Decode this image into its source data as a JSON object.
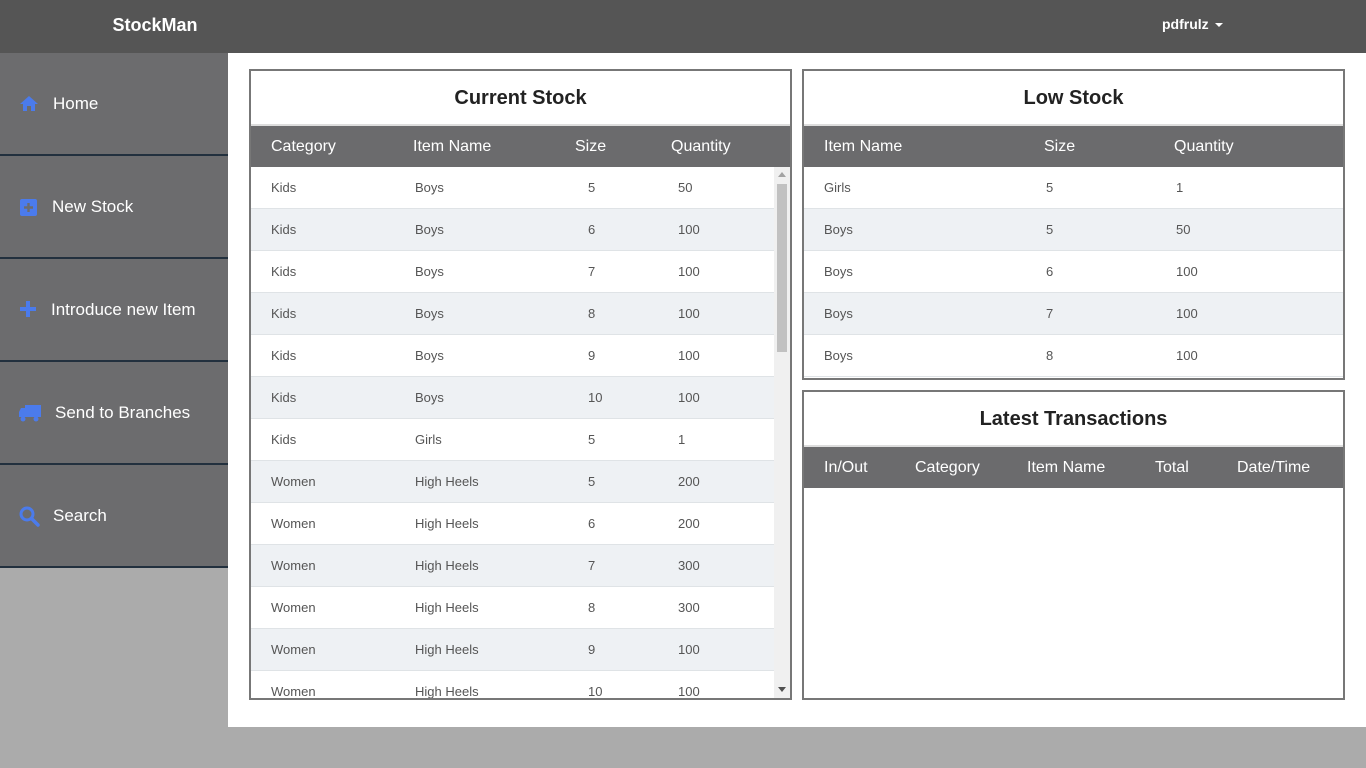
{
  "app": {
    "brand": "StockMan",
    "user": "pdfrulz"
  },
  "sidebar": {
    "items": [
      {
        "label": "Home",
        "icon": "home-icon"
      },
      {
        "label": "New Stock",
        "icon": "plus-square-icon"
      },
      {
        "label": "Introduce new Item",
        "icon": "plus-icon"
      },
      {
        "label": "Send to Branches",
        "icon": "truck-icon"
      },
      {
        "label": "Search",
        "icon": "search-icon"
      }
    ]
  },
  "current_stock": {
    "title": "Current Stock",
    "columns": [
      "Category",
      "Item Name",
      "Size",
      "Quantity"
    ],
    "rows": [
      [
        "Kids",
        "Boys",
        "5",
        "50"
      ],
      [
        "Kids",
        "Boys",
        "6",
        "100"
      ],
      [
        "Kids",
        "Boys",
        "7",
        "100"
      ],
      [
        "Kids",
        "Boys",
        "8",
        "100"
      ],
      [
        "Kids",
        "Boys",
        "9",
        "100"
      ],
      [
        "Kids",
        "Boys",
        "10",
        "100"
      ],
      [
        "Kids",
        "Girls",
        "5",
        "1"
      ],
      [
        "Women",
        "High Heels",
        "5",
        "200"
      ],
      [
        "Women",
        "High Heels",
        "6",
        "200"
      ],
      [
        "Women",
        "High Heels",
        "7",
        "300"
      ],
      [
        "Women",
        "High Heels",
        "8",
        "300"
      ],
      [
        "Women",
        "High Heels",
        "9",
        "100"
      ],
      [
        "Women",
        "High Heels",
        "10",
        "100"
      ]
    ]
  },
  "low_stock": {
    "title": "Low Stock",
    "columns": [
      "Item Name",
      "Size",
      "Quantity"
    ],
    "rows": [
      [
        "Girls",
        "5",
        "1"
      ],
      [
        "Boys",
        "5",
        "50"
      ],
      [
        "Boys",
        "6",
        "100"
      ],
      [
        "Boys",
        "7",
        "100"
      ],
      [
        "Boys",
        "8",
        "100"
      ]
    ]
  },
  "transactions": {
    "title": "Latest Transactions",
    "columns": [
      "In/Out",
      "Category",
      "Item Name",
      "Total",
      "Date/Time"
    ],
    "rows": []
  },
  "colors": {
    "topbar": "#555555",
    "sidebar_item": "#6c6c6e",
    "icon_accent": "#4b7bec",
    "table_header": "#6b6b6d",
    "row_alt": "#eef1f4"
  }
}
